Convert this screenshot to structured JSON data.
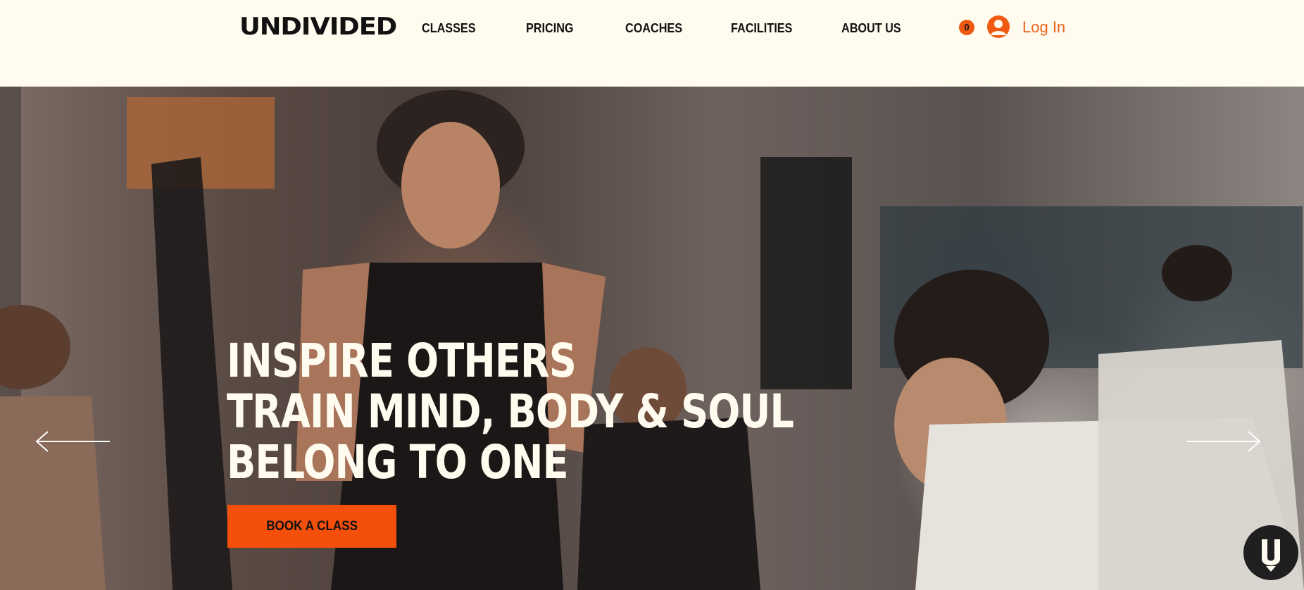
{
  "header": {
    "logo_text": "UNDIVIDED",
    "nav": [
      {
        "label": "CLASSES"
      },
      {
        "label": "PRICING"
      },
      {
        "label": "COACHES"
      },
      {
        "label": "FACILITIES"
      },
      {
        "label": "ABOUT US"
      }
    ],
    "cart_count": "0",
    "login_label": "Log In"
  },
  "hero": {
    "headline_lines": [
      "INSPIRE OTHERS",
      "TRAIN MIND, BODY & SOUL",
      "BELONG TO ONE"
    ],
    "cta_label": "BOOK A CLASS",
    "prev_icon": "arrow-left-icon",
    "next_icon": "arrow-right-icon"
  },
  "colors": {
    "background": "#fffbee",
    "accent": "#f4500c",
    "text_dark": "#111111",
    "login": "#e9641d"
  },
  "icons": {
    "avatar": "user-avatar-icon",
    "chat": "chat-widget-icon"
  }
}
